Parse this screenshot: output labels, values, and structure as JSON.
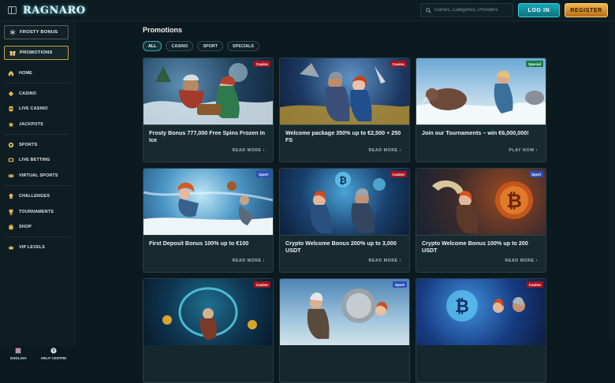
{
  "header": {
    "logo": "RAGNARO",
    "search_placeholder": "Games, Categories, Providers",
    "login_label": "LOG IN",
    "register_label": "REGISTER",
    "login_color": "#17a7b4",
    "register_color": "#f2b64a"
  },
  "sidebar": {
    "pills": [
      {
        "label": "FROSTY BONUS",
        "icon": "snowflake-icon"
      },
      {
        "label": "PROMOTIONS",
        "icon": "promotions-icon",
        "active": true
      }
    ],
    "items": [
      {
        "label": "HOME",
        "icon": "home-icon"
      },
      {
        "label": "CASINO",
        "icon": "casino-icon"
      },
      {
        "label": "LIVE CASINO",
        "icon": "live-casino-icon"
      },
      {
        "label": "JACKPOTS",
        "icon": "jackpot-icon"
      },
      {
        "label": "SPORTS",
        "icon": "sports-icon"
      },
      {
        "label": "LIVE BETTING",
        "icon": "live-betting-icon"
      },
      {
        "label": "VIRTUAL SPORTS",
        "icon": "virtual-sports-icon"
      },
      {
        "label": "CHALLENGES",
        "icon": "challenges-icon"
      },
      {
        "label": "TOURNAMENTS",
        "icon": "tournaments-icon"
      },
      {
        "label": "SHOP",
        "icon": "shop-icon"
      },
      {
        "label": "VIP LEVELS",
        "icon": "vip-icon"
      }
    ],
    "footer": {
      "language": "ENGLISH",
      "help": "HELP CENTRE"
    }
  },
  "main": {
    "title": "Promotions",
    "filters": [
      {
        "label": "ALL",
        "active": true
      },
      {
        "label": "CASINO"
      },
      {
        "label": "SPORT"
      },
      {
        "label": "SPECIALS"
      }
    ],
    "cards": [
      {
        "title": "Frosty Bonus 777,000 Free Spins Frozen In Ice",
        "cta": "READ MORE",
        "badge": "Casino",
        "badge_type": "casino"
      },
      {
        "title": "Welcome package 350% up to €2,500 + 250 FS",
        "cta": "READ MORE",
        "badge": "Casino",
        "badge_type": "casino"
      },
      {
        "title": "Join our Tournaments – win €6,000,000!",
        "cta": "PLAY NOW",
        "badge": "Special",
        "badge_type": "special"
      },
      {
        "title": "First Deposit Bonus 100% up to €100",
        "cta": "READ MORE",
        "badge": "Sport",
        "badge_type": "sport"
      },
      {
        "title": "Crypto Welcome Bonus 200% up to 3,000 USDT",
        "cta": "READ MORE",
        "badge": "Casino",
        "badge_type": "casino"
      },
      {
        "title": "Crypto Welcome Bonus 100% up to 200 USDT",
        "cta": "READ MORE",
        "badge": "Sport",
        "badge_type": "sport"
      },
      {
        "title": "",
        "cta": "",
        "badge": "Casino",
        "badge_type": "casino"
      },
      {
        "title": "",
        "cta": "",
        "badge": "Sport",
        "badge_type": "sport"
      },
      {
        "title": "",
        "cta": "",
        "badge": "Casino",
        "badge_type": "casino"
      }
    ]
  }
}
